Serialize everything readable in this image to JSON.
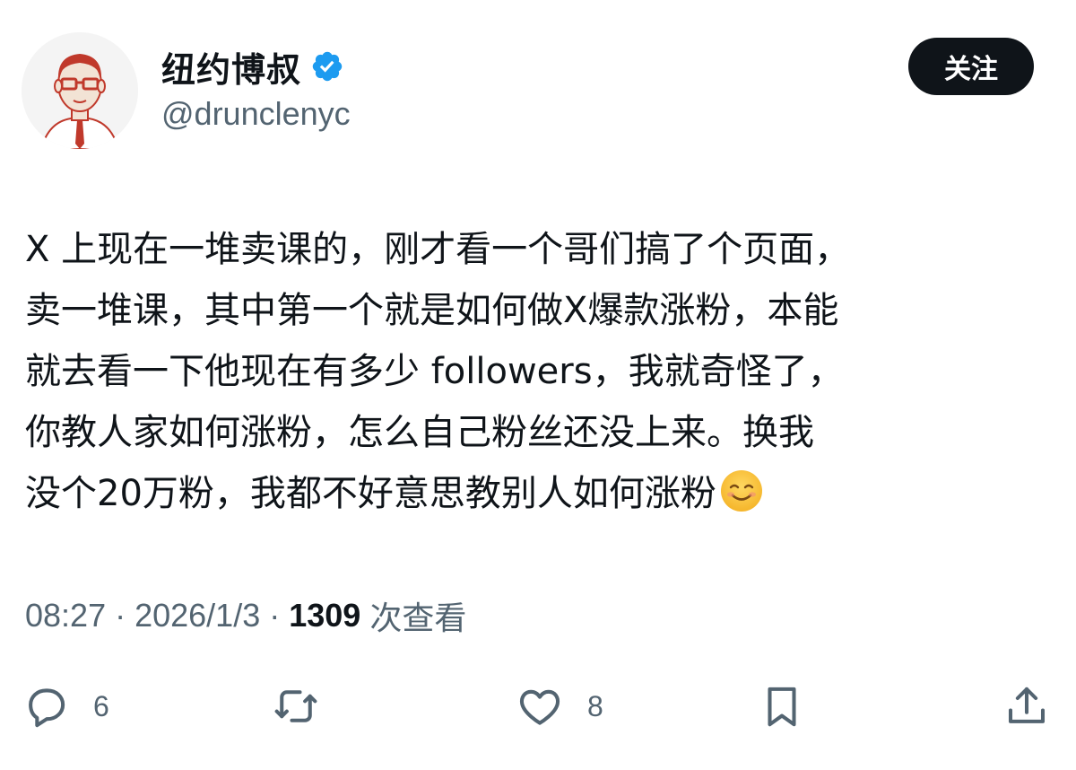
{
  "author": {
    "display_name": "纽约博叔",
    "handle": "@drunclenyc",
    "verified": true,
    "verified_color": "#1d9bf0"
  },
  "follow_button": {
    "label": "关注"
  },
  "tweet": {
    "lines": [
      "X 上现在一堆卖课的，刚才看一个哥们搞了个页面，",
      "卖一堆课，其中第一个就是如何做X爆款涨粉，本能",
      "就去看一下他现在有多少 followers，我就奇怪了，",
      "你教人家如何涨粉，怎么自己粉丝还没上来。换我",
      "没个20万粉，我都不好意思教别人如何涨粉"
    ],
    "emoji": "smiling-face-icon"
  },
  "meta": {
    "time": "08:27",
    "separator": "·",
    "date": "2026/1/3",
    "views_count": "1309",
    "views_label": "次查看"
  },
  "actions": {
    "reply": {
      "icon": "reply-icon",
      "count": "6"
    },
    "repost": {
      "icon": "repost-icon",
      "count": ""
    },
    "like": {
      "icon": "like-icon",
      "count": "8"
    },
    "bookmark": {
      "icon": "bookmark-icon",
      "count": ""
    },
    "share": {
      "icon": "share-icon",
      "count": ""
    }
  },
  "colors": {
    "text_primary": "#0f1419",
    "text_secondary": "#536471",
    "button_bg": "#0f1419",
    "button_text": "#ffffff"
  }
}
